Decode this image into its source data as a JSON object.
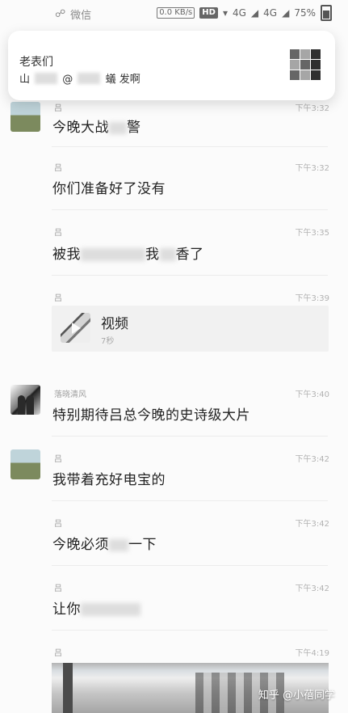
{
  "status_bar": {
    "app_label": "微信",
    "network_speed": "0.0\nKB/s",
    "hd_label": "HD",
    "signal_1": "4G",
    "signal_2": "4G",
    "battery_text": "75%"
  },
  "notification": {
    "title": "老表们",
    "body_prefix": "山",
    "body_middle": "@",
    "body_suffix": "蟻 发啊"
  },
  "messages": [
    {
      "name": "吕",
      "time": "下午3:32",
      "text": "今晚大战",
      "suffix": "警"
    },
    {
      "name": "吕",
      "time": "下午3:32",
      "text": "你们准备好了没有"
    },
    {
      "name": "吕",
      "time": "下午3:35",
      "text": "被我",
      "middle": "我",
      "suffix": "香了"
    },
    {
      "name": "吕",
      "time": "下午3:39"
    },
    {
      "name": "落晓清风",
      "time": "下午3:40",
      "text": "特别期待吕总今晚的史诗级大片"
    },
    {
      "name": "吕",
      "time": "下午3:42",
      "text": "我带着充好电宝的"
    },
    {
      "name": "吕",
      "time": "下午3:42",
      "text": "今晚必须",
      "suffix": "一下"
    },
    {
      "name": "吕",
      "time": "下午3:42",
      "text": "让你"
    },
    {
      "name": "吕",
      "time": "下午4:19"
    }
  ],
  "video": {
    "title": "视频",
    "duration": "7秒"
  },
  "watermark": "知乎 @小蓓同学"
}
